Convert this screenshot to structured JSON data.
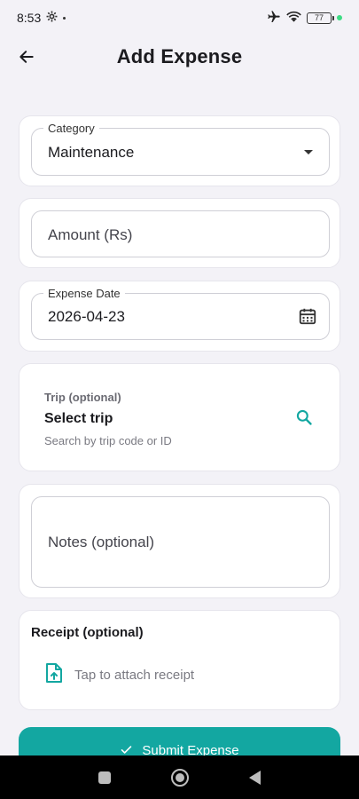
{
  "status_bar": {
    "time": "8:53",
    "battery": "77"
  },
  "header": {
    "title": "Add Expense"
  },
  "form": {
    "category": {
      "label": "Category",
      "value": "Maintenance"
    },
    "amount": {
      "placeholder": "Amount (Rs)"
    },
    "expense_date": {
      "label": "Expense Date",
      "value": "2026-04-23"
    },
    "trip": {
      "label": "Trip (optional)",
      "value": "Select trip",
      "helper": "Search by trip code or ID"
    },
    "notes": {
      "placeholder": "Notes (optional)"
    },
    "receipt": {
      "title": "Receipt (optional)",
      "attach_label": "Tap to attach receipt"
    }
  },
  "submit": {
    "label": "Submit Expense"
  },
  "colors": {
    "accent": "#13a7a1",
    "background": "#f3f2f7"
  },
  "icons": {
    "back": "arrow-left-icon",
    "dropdown": "caret-down-icon",
    "calendar": "calendar-icon",
    "search": "search-icon",
    "receipt": "file-upload-icon",
    "check": "check-icon"
  }
}
